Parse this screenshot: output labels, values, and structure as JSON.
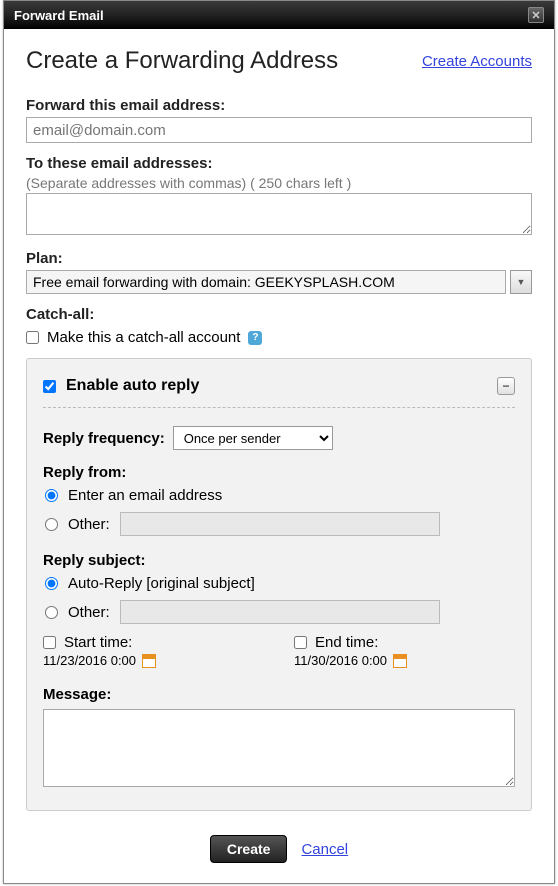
{
  "window": {
    "title": "Forward Email"
  },
  "header": {
    "title": "Create a Forwarding Address",
    "create_accounts_link": "Create Accounts"
  },
  "forward_from": {
    "label": "Forward this email address:",
    "placeholder": "email@domain.com"
  },
  "forward_to": {
    "label": "To these email addresses:",
    "hint": "(Separate addresses with commas) ( 250 chars left )"
  },
  "plan": {
    "label": "Plan:",
    "value": "Free email forwarding with domain: GEEKYSPLASH.COM"
  },
  "catchall": {
    "label": "Catch-all:",
    "checkbox_label": "Make this a catch-all account"
  },
  "auto_reply": {
    "enable_label": "Enable auto reply",
    "reply_frequency_label": "Reply frequency:",
    "reply_frequency_value": "Once per sender",
    "reply_from_label": "Reply from:",
    "reply_from_opt1": "Enter an email address",
    "reply_from_opt2": "Other:",
    "reply_subject_label": "Reply subject:",
    "reply_subject_opt1": "Auto-Reply [original subject]",
    "reply_subject_opt2": "Other:",
    "start_label": "Start time:",
    "start_value": "11/23/2016 0:00",
    "end_label": "End time:",
    "end_value": "11/30/2016 0:00",
    "message_label": "Message:"
  },
  "footer": {
    "create": "Create",
    "cancel": "Cancel"
  }
}
